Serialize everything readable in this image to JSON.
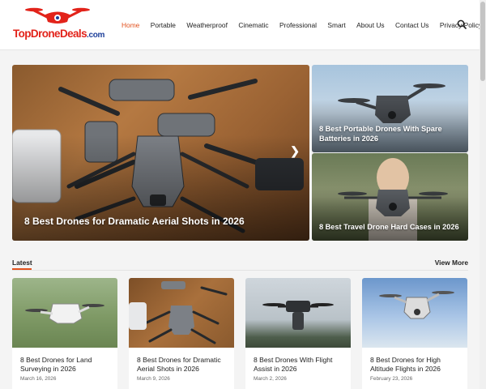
{
  "site": {
    "logo_part1": "TopDrone",
    "logo_part2": "Deals",
    "logo_part3": ".com"
  },
  "nav": {
    "items": [
      "Home",
      "Portable",
      "Weatherproof",
      "Cinematic",
      "Professional",
      "Smart",
      "About Us",
      "Contact Us",
      "Privacy Policy"
    ],
    "active": "Home"
  },
  "hero": {
    "main_title": "8 Best Drones for Dramatic Aerial Shots in 2026",
    "side1_title": "8 Best Portable Drones With Spare Batteries in 2026",
    "side2_title": "8 Best Travel Drone Hard Cases in 2026"
  },
  "latest": {
    "heading": "Latest",
    "view_more": "View More",
    "cards": [
      {
        "title": "8 Best Drones for Land Surveying in 2026",
        "date": "March 16, 2026"
      },
      {
        "title": "8 Best Drones for Dramatic Aerial Shots in 2026",
        "date": "March 9, 2026"
      },
      {
        "title": "8 Best Drones With Flight Assist in 2026",
        "date": "March 2, 2026"
      },
      {
        "title": "8 Best Drones for High Altitude Flights in 2026",
        "date": "February 23, 2026"
      }
    ]
  },
  "colors": {
    "accent": "#e2521f",
    "logo_red": "#e2231a",
    "logo_blue": "#1c3f9a"
  },
  "icons": {
    "search": "search-icon",
    "slider_next": "chevron-right-icon",
    "logo": "drone-icon"
  }
}
